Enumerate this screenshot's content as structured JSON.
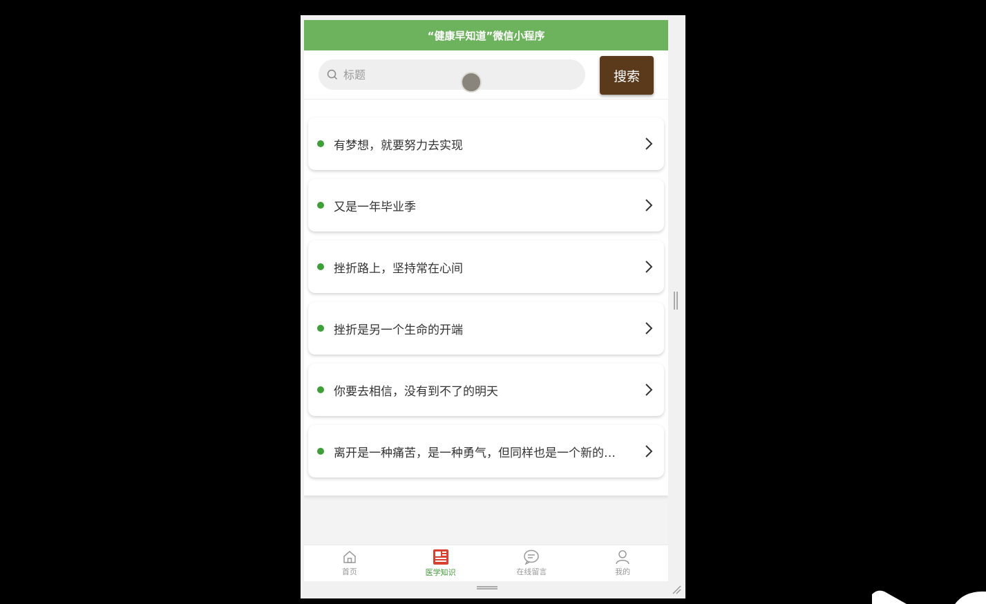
{
  "header": {
    "title": "“健康早知道”微信小程序"
  },
  "search": {
    "placeholder": "标题",
    "button_label": "搜索"
  },
  "articles": [
    "有梦想，就要努力去实现",
    "又是一年毕业季",
    "挫折路上，坚持常在心间",
    "挫折是另一个生命的开端",
    "你要去相信，没有到不了的明天",
    "离开是一种痛苦，是一种勇气，但同样也是一个新的开始"
  ],
  "tabbar": {
    "items": [
      {
        "label": "首页",
        "icon": "home-icon"
      },
      {
        "label": "医学知识",
        "icon": "news-icon",
        "active": true
      },
      {
        "label": "在线留言",
        "icon": "message-icon"
      },
      {
        "label": "我的",
        "icon": "user-icon"
      }
    ]
  },
  "colors": {
    "header_bg": "#6db35d",
    "search_button_bg": "#5b3a1c",
    "bullet": "#3e9e38",
    "active_tab": "#3f9a34"
  }
}
